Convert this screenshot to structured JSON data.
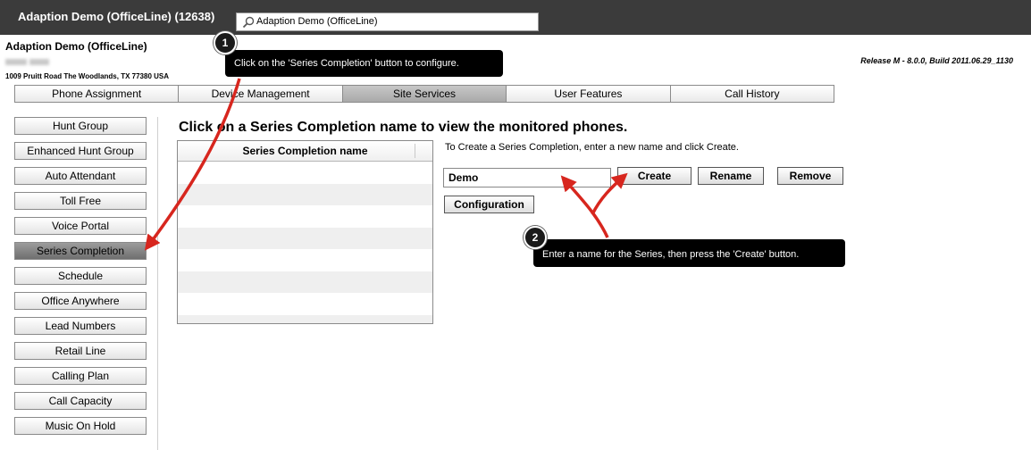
{
  "header": {
    "app_title": "Adaption Demo (OfficeLine) (12638)",
    "search_value": "Adaption Demo (OfficeLine)"
  },
  "account": {
    "name": "Adaption Demo (OfficeLine)",
    "address": "1009 Pruitt Road The Woodlands, TX 77380 USA",
    "release": "Release M - 8.0.0, Build 2011.06.29_1130"
  },
  "tabs": [
    {
      "label": "Phone Assignment"
    },
    {
      "label": "Device Management"
    },
    {
      "label": "Site Services",
      "active": true
    },
    {
      "label": "User Features"
    },
    {
      "label": "Call History"
    }
  ],
  "sidebar": {
    "items": [
      {
        "label": "Hunt Group"
      },
      {
        "label": "Enhanced Hunt Group"
      },
      {
        "label": "Auto Attendant"
      },
      {
        "label": "Toll Free"
      },
      {
        "label": "Voice Portal"
      },
      {
        "label": "Series Completion",
        "active": true
      },
      {
        "label": "Schedule"
      },
      {
        "label": "Office Anywhere"
      },
      {
        "label": "Lead Numbers"
      },
      {
        "label": "Retail Line"
      },
      {
        "label": "Calling Plan"
      },
      {
        "label": "Call Capacity"
      },
      {
        "label": "Music On Hold"
      }
    ]
  },
  "main": {
    "heading": "Click on a Series Completion name to view the monitored phones.",
    "table": {
      "column_header": "Series Completion name",
      "rows": []
    },
    "create_instructions": "To Create a Series Completion, enter a new name and click Create.",
    "name_input_value": "Demo",
    "buttons": {
      "create": "Create",
      "rename": "Rename",
      "remove": "Remove",
      "configuration": "Configuration"
    }
  },
  "callouts": {
    "one": {
      "number": "1",
      "text": "Click on the 'Series Completion' button to configure."
    },
    "two": {
      "number": "2",
      "text": "Enter a name for the Series, then press the 'Create' button."
    }
  },
  "colors": {
    "topbar": "#3b3b3b",
    "arrow": "#d7261e",
    "active_tab": "#a9a9a9",
    "active_sidebar": "#7a7a7a"
  }
}
